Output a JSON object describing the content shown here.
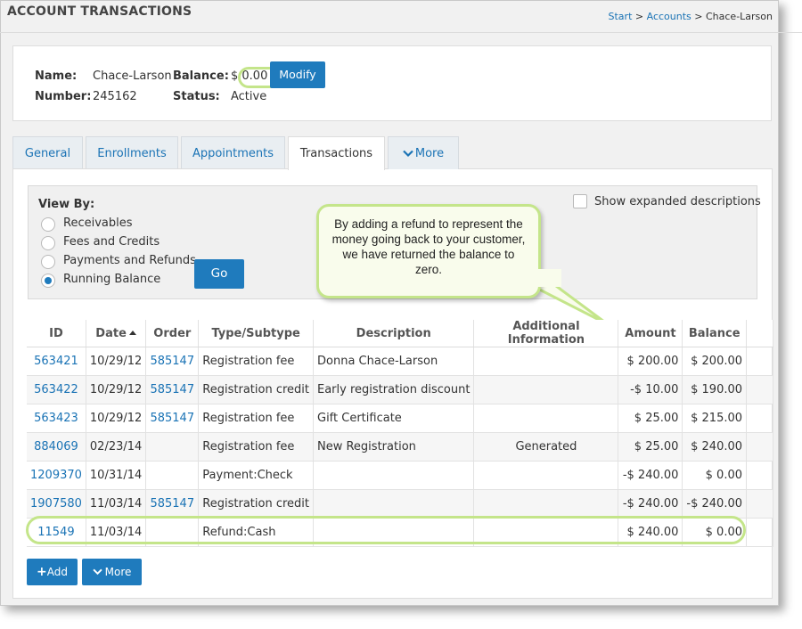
{
  "header": {
    "title": "ACCOUNT TRANSACTIONS",
    "breadcrumb": {
      "start": "Start",
      "sep1": " > ",
      "accounts": "Accounts",
      "sep2": " > ",
      "current": "Chace-Larson"
    }
  },
  "account": {
    "name_label": "Name:",
    "name": "Chace-Larson",
    "balance_label": "Balance:",
    "balance": "$ 0.00",
    "modify_label": "Modify",
    "number_label": "Number:",
    "number": "245162",
    "status_label": "Status:",
    "status": "Active"
  },
  "tabs": [
    {
      "label": "General"
    },
    {
      "label": "Enrollments"
    },
    {
      "label": "Appointments"
    },
    {
      "label": "Transactions",
      "active": true
    },
    {
      "label": "More"
    }
  ],
  "viewby": {
    "heading": "View By:",
    "options": [
      {
        "label": "Receivables",
        "selected": false
      },
      {
        "label": "Fees and Credits",
        "selected": false
      },
      {
        "label": "Payments and Refunds",
        "selected": false
      },
      {
        "label": "Running Balance",
        "selected": true
      }
    ],
    "go_label": "Go",
    "expanded_label": "Show expanded descriptions"
  },
  "callout": {
    "text": "By adding a refund to represent the money going back to your customer, we have returned the balance to zero."
  },
  "table": {
    "headers": [
      "ID",
      "Date",
      "Order",
      "Type/Subtype",
      "Description",
      "Additional Information",
      "Amount",
      "Balance"
    ],
    "rows": [
      {
        "id": "563421",
        "date": "10/29/12",
        "order": "585147",
        "type": "Registration fee",
        "description": "Donna Chace-Larson",
        "info": "",
        "amount": "$ 200.00",
        "balance": "$ 200.00"
      },
      {
        "id": "563422",
        "date": "10/29/12",
        "order": "585147",
        "type": "Registration credit",
        "description": "Early registration discount",
        "info": "",
        "amount": "-$ 10.00",
        "balance": "$ 190.00"
      },
      {
        "id": "563423",
        "date": "10/29/12",
        "order": "585147",
        "type": "Registration fee",
        "description": "Gift Certificate",
        "info": "",
        "amount": "$ 25.00",
        "balance": "$ 215.00"
      },
      {
        "id": "884069",
        "date": "02/23/14",
        "order": "",
        "type": "Registration fee",
        "description": "New Registration",
        "info": "Generated",
        "amount": "$ 25.00",
        "balance": "$ 240.00"
      },
      {
        "id": "1209370",
        "date": "10/31/14",
        "order": "",
        "type": "Payment:Check",
        "description": "",
        "info": "",
        "amount": "-$ 240.00",
        "balance": "$ 0.00"
      },
      {
        "id": "1907580",
        "date": "11/03/14",
        "order": "585147",
        "type": "Registration credit",
        "description": "",
        "info": "",
        "amount": "-$ 240.00",
        "balance": "-$ 240.00"
      },
      {
        "id": "11549",
        "date": "11/03/14",
        "order": "",
        "type": "Refund:Cash",
        "description": "",
        "info": "",
        "amount": "$ 240.00",
        "balance": "$ 0.00"
      }
    ]
  },
  "actions": {
    "add_label": "Add",
    "more_label": "More"
  },
  "colors": {
    "accent": "#1f7bbd",
    "link": "#1a73b5",
    "highlight": "#c4e58a"
  }
}
